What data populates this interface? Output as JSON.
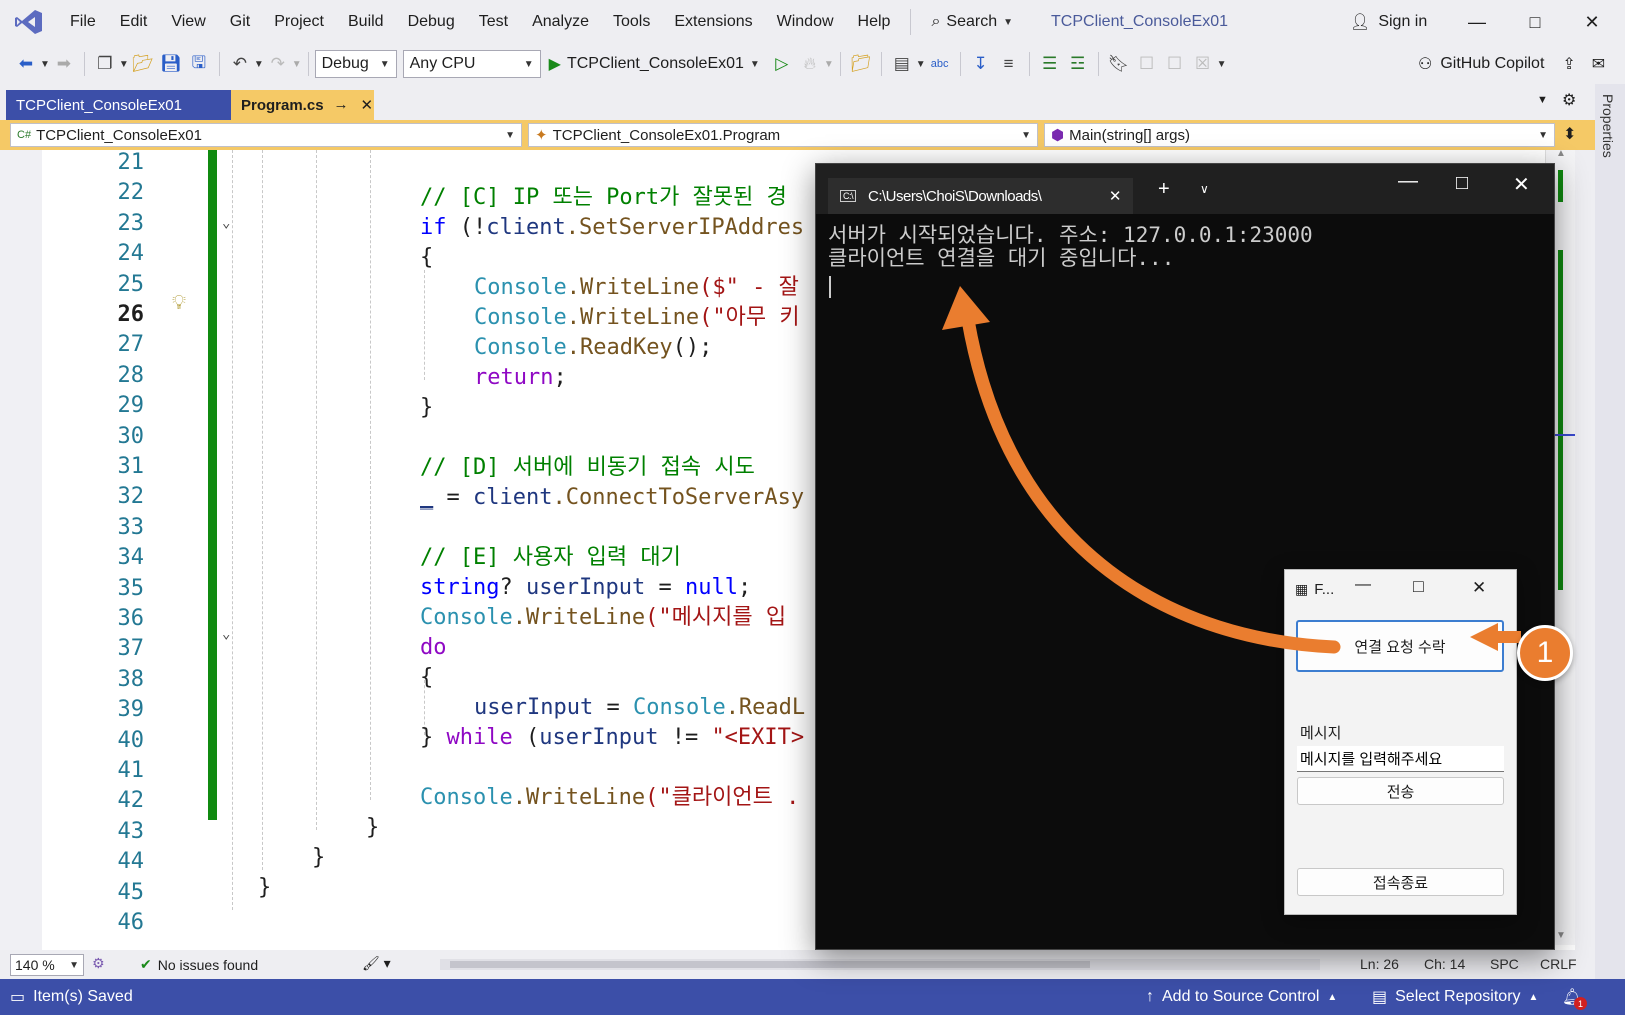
{
  "menu": {
    "items": [
      "File",
      "Edit",
      "View",
      "Git",
      "Project",
      "Build",
      "Debug",
      "Test",
      "Analyze",
      "Tools",
      "Extensions",
      "Window",
      "Help"
    ],
    "search_label": "Search",
    "solution_title": "TCPClient_ConsoleEx01",
    "sign_in": "Sign in"
  },
  "toolbar": {
    "configuration": "Debug",
    "platform": "Any CPU",
    "run_target": "TCPClient_ConsoleEx01",
    "copilot": "GitHub Copilot"
  },
  "tabs": {
    "project": "TCPClient_ConsoleEx01",
    "file": "Program.cs"
  },
  "properties_label": "Properties",
  "navbar": {
    "project": "TCPClient_ConsoleEx01",
    "type": "TCPClient_ConsoleEx01.Program",
    "member": "Main(string[] args)"
  },
  "editor": {
    "line_numbers": [
      "21",
      "22",
      "23",
      "24",
      "25",
      "26",
      "27",
      "28",
      "29",
      "30",
      "31",
      "32",
      "33",
      "34",
      "35",
      "36",
      "37",
      "38",
      "39",
      "40",
      "41",
      "42",
      "43",
      "44",
      "45",
      "46"
    ],
    "current_line": "26",
    "code": {
      "l22": "// [C] IP 또는 Port가 잘못된 경",
      "l23_if": "if",
      "l23_rest": " (!",
      "l23_client": "client",
      "l23_method": ".SetServerIPAddres",
      "l24": "{",
      "l25_type": "Console",
      "l25_method": ".WriteLine",
      "l25_str": "($\" - 잘",
      "l26_type": "Console",
      "l26_method": ".WriteLine",
      "l26_str": "(\"아무 키",
      "l27_type": "Console",
      "l27_method": ".ReadKey",
      "l27_rest": "();",
      "l28_kw": "return",
      "l28_rest": ";",
      "l29": "}",
      "l31": "// [D] 서버에 비동기 접속 시도",
      "l32_discard": "_",
      "l32_rest": " = ",
      "l32_client": "client",
      "l32_method": ".ConnectToServerAsy",
      "l34": "// [E] 사용자 입력 대기",
      "l35_kw": "string",
      "l35_q": "? ",
      "l35_var": "userInput",
      "l35_eq": " = ",
      "l35_null": "null",
      "l35_semi": ";",
      "l36_type": "Console",
      "l36_method": ".WriteLine",
      "l36_str": "(\"메시지를 입",
      "l37_kw": "do",
      "l38": "{",
      "l39_var": "userInput",
      "l39_eq": " = ",
      "l39_type": "Console",
      "l39_method": ".ReadL",
      "l40_brace": "} ",
      "l40_kw": "while",
      "l40_open": " (",
      "l40_var": "userInput",
      "l40_ne": " != ",
      "l40_str": "\"<EXIT>",
      "l42_type": "Console",
      "l42_method": ".WriteLine",
      "l42_str": "(\"클라이언트 .",
      "l43": "}",
      "l44": "}",
      "l45": "}"
    }
  },
  "editor_status": {
    "zoom": "140 %",
    "issues": "No issues found",
    "line": "Ln: 26",
    "column": "Ch: 14",
    "whitespace": "SPC",
    "line_ending": "CRLF"
  },
  "statusbar": {
    "message": "Item(s) Saved",
    "source_control": "Add to Source Control",
    "repository": "Select Repository",
    "notifications": "1"
  },
  "terminal": {
    "tab_title": "C:\\Users\\ChoiS\\Downloads\\",
    "lines": [
      "서버가 시작되었습니다. 주소: 127.0.0.1:23000",
      "클라이언트 연결을 대기 중입니다..."
    ]
  },
  "form": {
    "title": "F...",
    "accept_button": "연결 요청 수락",
    "message_label": "메시지",
    "message_input": "메시지를 입력해주세요",
    "send_button": "전송",
    "disconnect_button": "접속종료"
  },
  "annotation": {
    "step_number": "1",
    "color": "#ea7d2f"
  },
  "colors": {
    "accent": "#3c4fa8",
    "active_tab": "#f5c966",
    "change_bar": "#108a10"
  }
}
